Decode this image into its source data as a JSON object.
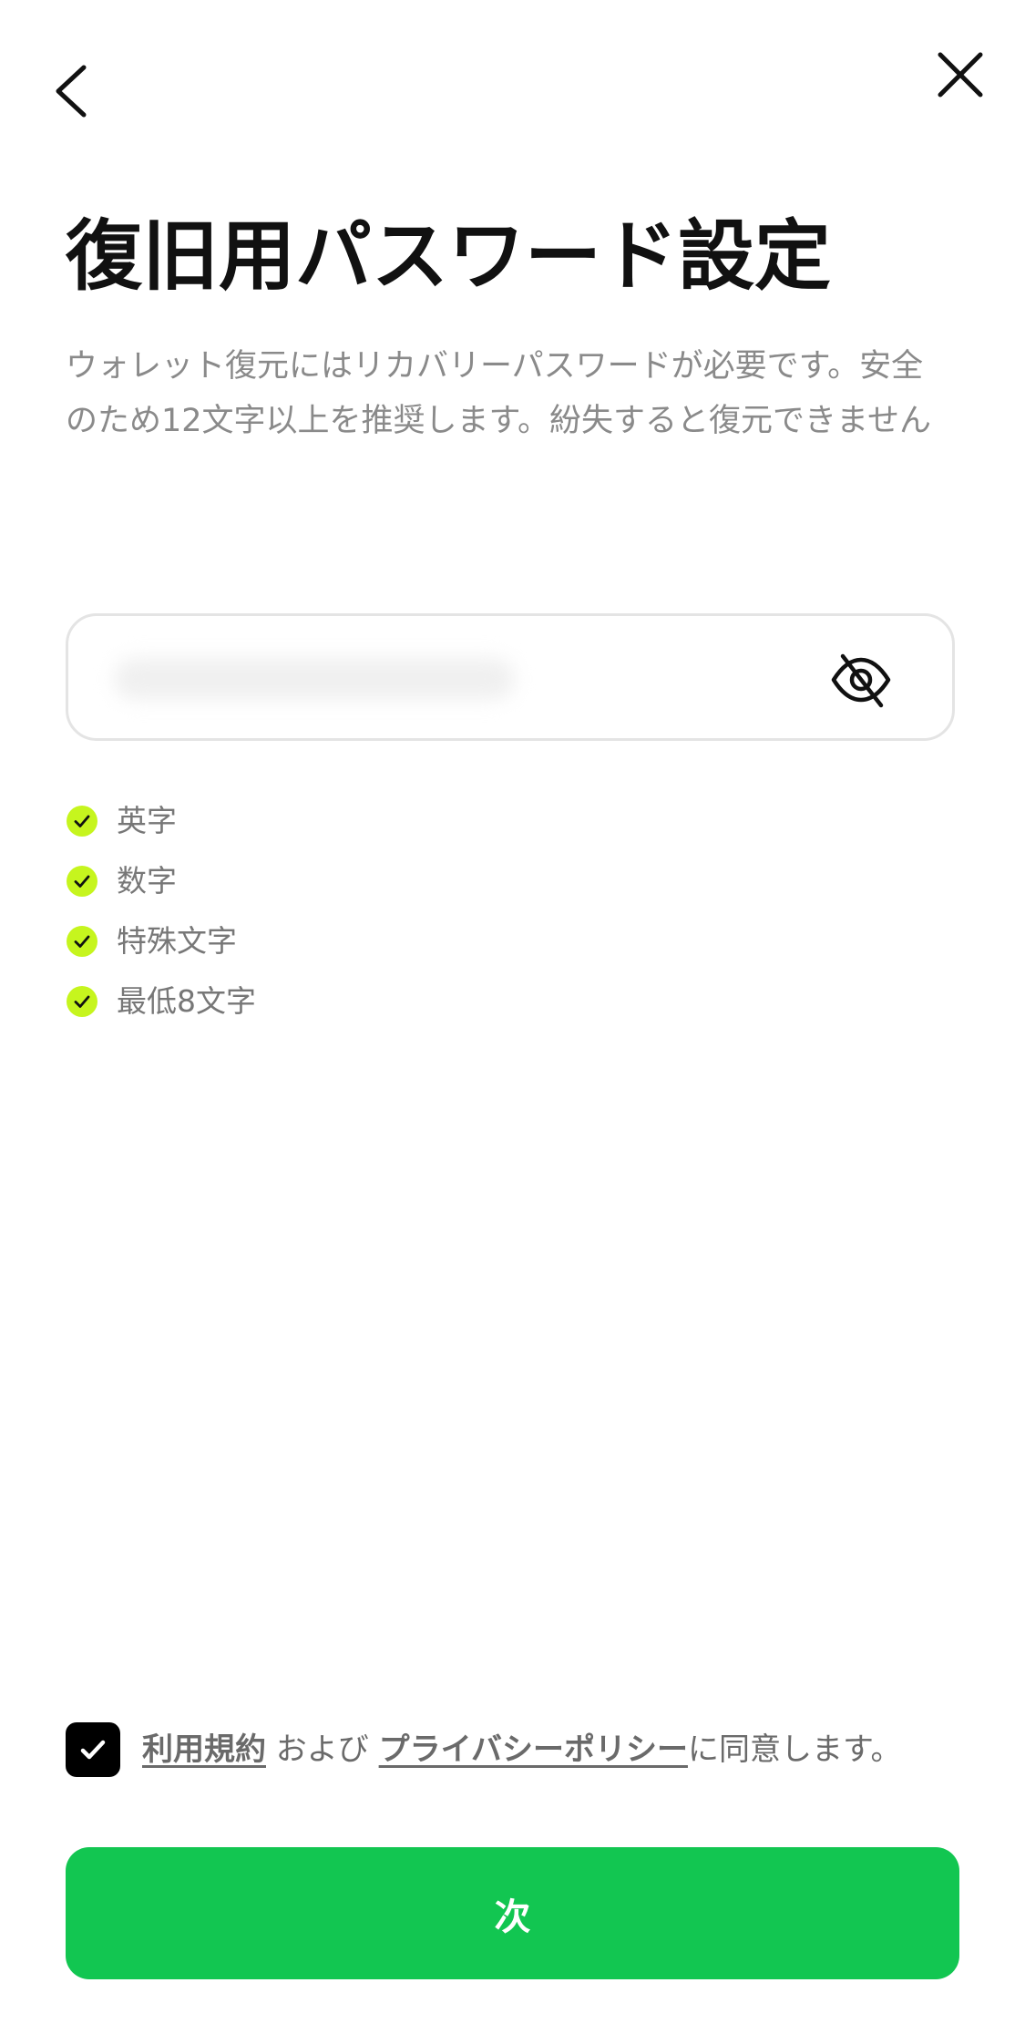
{
  "nav": {
    "back_icon": "chevron-left-icon",
    "close_icon": "close-icon"
  },
  "title": "復旧用パスワード設定",
  "description": "ウォレット復元にはリカバリーパスワードが必要です。安全のため12文字以上を推奨します。紛失すると復元できません",
  "password_field": {
    "value": "",
    "masked": false,
    "visibility_icon": "eye-off-icon"
  },
  "rules": [
    {
      "label": "英字",
      "met": true
    },
    {
      "label": "数字",
      "met": true
    },
    {
      "label": "特殊文字",
      "met": true
    },
    {
      "label": "最低8文字",
      "met": true
    }
  ],
  "consent": {
    "checked": true,
    "terms_link": "利用規約",
    "and_text": " および ",
    "privacy_link": "プライバシーポリシー",
    "suffix": "に同意します。"
  },
  "next_button": {
    "label": "次"
  },
  "colors": {
    "accent_green": "#12c651",
    "check_lime": "#c6f51e",
    "title": "#111111",
    "muted_text": "#8a8a8a"
  }
}
